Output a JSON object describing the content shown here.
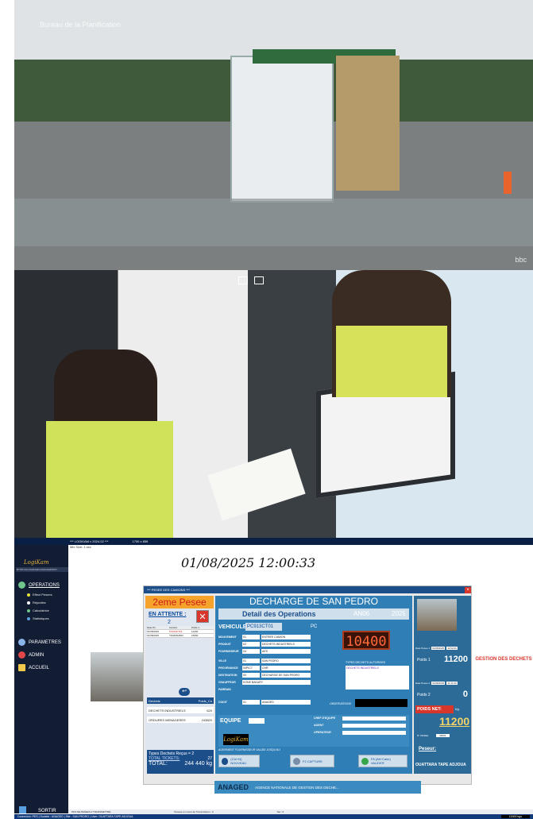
{
  "photo_top": {
    "watermark": "Bureau de la Planification",
    "badge": "bbc"
  },
  "app": {
    "title": "*** LOGIKAM v 2024.02 ***",
    "resolution": "1700 x 859",
    "subtitle": "Mix Size: 1 sec",
    "license": "BY:BYC0-LOGIKAM/LOGIKAM/PROT-",
    "datetime": "01/08/2025 12:00:33",
    "sidebar": {
      "logo": "LogiKam",
      "operations": "OPERATIONS",
      "sub_items": [
        "Effect Pesees",
        "Rejouties",
        "Calculatrice",
        "Statistiques"
      ],
      "parametres": "PARAMETRES",
      "admin": "ADMIN",
      "accueil": "ACCUEIL",
      "sortir": "SORTIR"
    },
    "popup": {
      "title": "*** PESEE DES CAMIONS ***",
      "left": {
        "pesee_title": "2eme Pesee",
        "attente_label": "EN ATTENTE :",
        "attente_count": "2",
        "table_headers": [
          "Date P1",
          "Camion",
          "Poids 1"
        ],
        "table_rows": [
          [
            "01/08/2025",
            "PC913CT01",
            "11200"
          ],
          [
            "01/08/2025",
            "TR4406LB03",
            "15060"
          ]
        ],
        "dechets_header": [
          "Dechets",
          "Poids_Cu"
        ],
        "dechets_rows": [
          [
            "DECHETS INDUSTRIELS",
            "620"
          ],
          [
            "ORDURES MENAGERES",
            "243820"
          ]
        ],
        "types_recus": "Types Dechets Reçus = 2",
        "total_tickets_label": "TOTAL TICKETS:",
        "total_tickets_val": "27",
        "total_label": "TOTAL:",
        "total_val": "244 440 kg"
      },
      "main": {
        "title": "DECHARGE DE SAN PEDRO",
        "detail": "Detail des Operations",
        "an": "AN06",
        "year": "2025",
        "vehicule_label": "VEHICULE",
        "vehicule_val": "PC913CT01",
        "pc": "PC",
        "poids": "10400",
        "fields": [
          {
            "label": "MOUVEMENT",
            "code": "01",
            "value": "ENTREE CAMION"
          },
          {
            "label": "PRODUIT",
            "code": "02",
            "value": "DECHETS INDUSTRIELS"
          },
          {
            "label": "FOURNISSEUR",
            "code": "04",
            "value": "AES"
          },
          {
            "label": "VILLE",
            "code": "01",
            "value": "SAN PEDRO"
          },
          {
            "label": "PROVENANCE",
            "code": "00PIC7",
            "value": "CHR"
          },
          {
            "label": "DESTINATION",
            "code": "00",
            "value": "DECHARGE DE SAN PEDRO"
          },
          {
            "label": "CHAUFFEUR",
            "code": "KONE BAKARY",
            "value": ""
          },
          {
            "label": "PARRAIN",
            "code": "",
            "value": ""
          },
          {
            "label": "CODIT",
            "code": "01",
            "value": "ANAGED"
          }
        ],
        "types_auth_label": "TYPES DECHETS AUTORISES",
        "types_auth_val": "DECHETS INDUSTRIELS",
        "observations": "OBSERVATIONS",
        "equipe": "EQUIPE",
        "chef": "CHEF D'EQUIPE",
        "agent": "AGENT",
        "operateur": "OPERATEUR",
        "logo": "LogiKam",
        "agrement": "AGREMENT FOURNISSEUR VALIDE JUSQU'AU",
        "btn_nouveau": "(Ctrl+N) NOUVEAU",
        "btn_capture": "F2 CAPTURE",
        "btn_valider": "F8 (Alt+Calm) VALIDER"
      },
      "right": {
        "date_p1_label": "Date Pesee 1",
        "date_p1": "01/08/2025",
        "time_p1": "11:52:00",
        "poids1_label": "Poids 1",
        "poids1": "11200",
        "date_p2_label": "Date Pesee 2",
        "date_p2": "01/08/2025",
        "time_p2": "11:41:00",
        "poids2_label": "Poids 2",
        "poids2": "0",
        "poids_net_label": "POIDS NET:",
        "unit": "Kg",
        "poids_net": "11200",
        "ticket_label": "N° PESEE",
        "ticket_val": "36401",
        "peseur_label": "Peseur:",
        "peseur_name": "OUATTARA TAPE ADJOUA"
      }
    },
    "deco": {
      "gestion": "GESTION DES DECHETS",
      "kam": "Kam"
    },
    "anaged": {
      "short": "ANAGED",
      "long": "AGENCE NATIONALE DE GESTION DES DECHE..."
    },
    "status": {
      "left": "PAS DE PESEES A TRANSMETTRE",
      "mid": "Pesees en cours de Transmission : 0",
      "right": "Sel.: 0"
    },
    "footer": {
      "company": "Connexion: PES | Societe : ANAGED | Site : SAN PEDRO | User: OUATTARA TAPE ADJOUA",
      "weight": "10400 kgs"
    },
    "colors": {
      "sidebar": "#121c33",
      "panel": "#2f7fb6",
      "accent": "#d9362b",
      "orange": "#f5a32a"
    }
  }
}
